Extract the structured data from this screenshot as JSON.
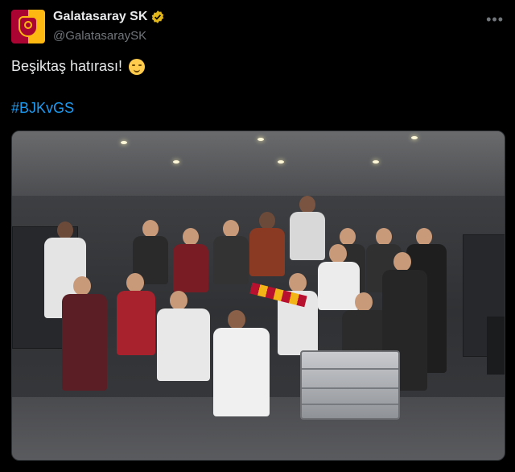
{
  "tweet": {
    "author": {
      "display_name": "Galatasaray SK",
      "handle": "@GalatasaraySK",
      "verified": true,
      "avatar_icon": "galatasaray-crest-icon",
      "brand_colors": {
        "red": "#a90432",
        "yellow": "#fdb912"
      }
    },
    "more_icon": "more-options-icon",
    "text": "Beşiktaş hatırası!",
    "emoji_icon": "relieved-face-emoji-icon",
    "hashtag": "#BJKvGS",
    "media": {
      "kind": "photo",
      "icon": "team-locker-room-celebration-photo"
    }
  },
  "colors": {
    "background": "#000000",
    "text": "#e7e9ea",
    "secondary": "#71767b",
    "link": "#1d9bf0",
    "verified_gold": "#e2b719"
  }
}
